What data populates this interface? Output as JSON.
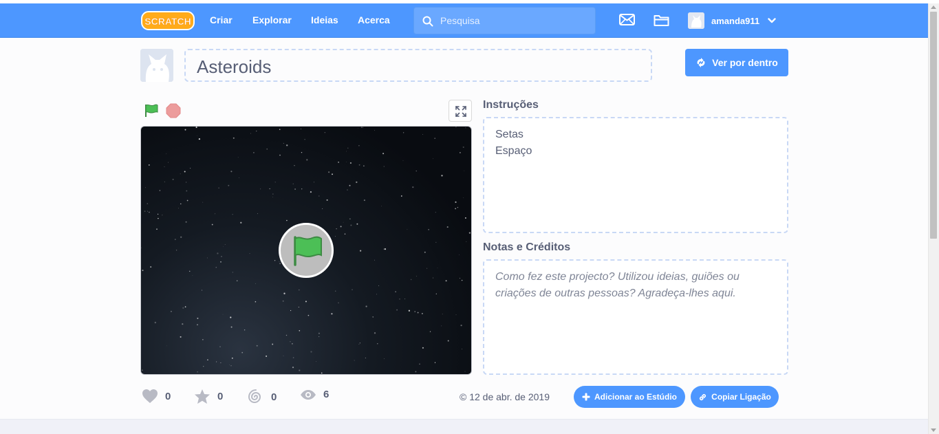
{
  "navbar": {
    "logo_text": "SCRATCH",
    "links": [
      "Criar",
      "Explorar",
      "Ideias",
      "Acerca"
    ],
    "search_placeholder": "Pesquisa",
    "username": "amanda911"
  },
  "project": {
    "title": "Asteroids",
    "see_inside_label": "Ver por dentro",
    "instructions_label": "Instruções",
    "instructions_lines": [
      "Setas",
      "Espaço"
    ],
    "notes_label": "Notas e Créditos",
    "notes_placeholder": "Como fez este projecto? Utilizou ideias, guiões ou criações de outras pessoas? Agradeça-lhes aqui."
  },
  "stats": {
    "loves": "0",
    "favorites": "0",
    "remixes": "0",
    "views": "6",
    "date": "© 12 de abr. de 2019"
  },
  "actions": {
    "add_to_studio": "Adicionar ao Estúdio",
    "copy_link": "Copiar Ligação"
  },
  "colors": {
    "brand_blue": "#4d97ff",
    "flag_green": "#4cbf56",
    "stop_red": "#ec9c9c"
  }
}
